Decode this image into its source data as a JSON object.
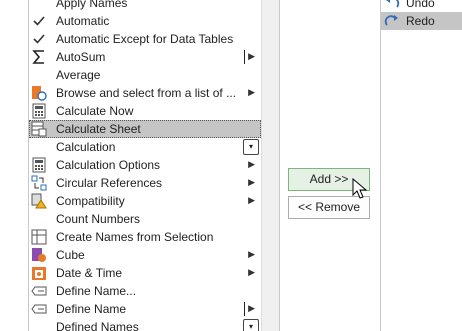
{
  "commands": [
    {
      "label": "Apply Names",
      "icon": "none-icon",
      "submenu": false
    },
    {
      "label": "Automatic",
      "icon": "checkmark-icon",
      "submenu": false
    },
    {
      "label": "Automatic Except for Data Tables",
      "icon": "checkmark-icon",
      "submenu": false
    },
    {
      "label": "AutoSum",
      "icon": "sigma-icon",
      "submenu": "bar"
    },
    {
      "label": "Average",
      "icon": "none-icon",
      "submenu": false
    },
    {
      "label": "Browse and select from a list of ...",
      "icon": "browse-icon",
      "submenu": "arrow"
    },
    {
      "label": "Calculate Now",
      "icon": "calculator-icon",
      "submenu": false
    },
    {
      "label": "Calculate Sheet",
      "icon": "calculate-sheet-icon",
      "submenu": false,
      "selected": true
    },
    {
      "label": "Calculation",
      "icon": "none-icon",
      "submenu": "dropdown"
    },
    {
      "label": "Calculation Options",
      "icon": "calculator-icon",
      "submenu": "arrow"
    },
    {
      "label": "Circular References",
      "icon": "circular-references-icon",
      "submenu": "arrow"
    },
    {
      "label": "Compatibility",
      "icon": "compatibility-warning-icon",
      "submenu": "arrow"
    },
    {
      "label": "Count Numbers",
      "icon": "none-icon",
      "submenu": false
    },
    {
      "label": "Create Names from Selection",
      "icon": "create-names-icon",
      "submenu": false
    },
    {
      "label": "Cube",
      "icon": "cube-icon",
      "submenu": "arrow"
    },
    {
      "label": "Date & Time",
      "icon": "calendar-icon",
      "submenu": "arrow"
    },
    {
      "label": "Define Name...",
      "icon": "define-name-icon",
      "submenu": false
    },
    {
      "label": "Define Name",
      "icon": "define-name-icon",
      "submenu": "bar"
    },
    {
      "label": "Defined Names",
      "icon": "none-icon",
      "submenu": "dropdown"
    }
  ],
  "buttons": {
    "add_label": "Add >>",
    "remove_label": "<< Remove"
  },
  "qat": [
    {
      "label": "Undo",
      "icon": "undo-icon"
    },
    {
      "label": "Redo",
      "icon": "redo-icon",
      "selected": true
    }
  ]
}
